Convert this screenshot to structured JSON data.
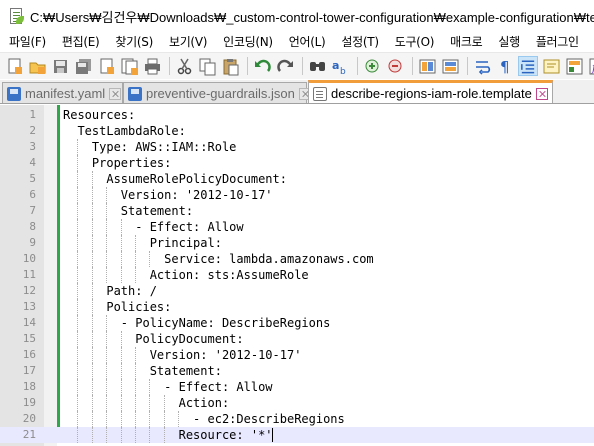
{
  "window": {
    "title": "C:₩Users₩김건우₩Downloads₩_custom-control-tower-configuration₩example-configuration₩templates₩d"
  },
  "menu": [
    "파일(F)",
    "편집(E)",
    "찾기(S)",
    "보기(V)",
    "인코딩(N)",
    "언어(L)",
    "설정(T)",
    "도구(O)",
    "매크로",
    "실행",
    "플러그인"
  ],
  "toolbar": {
    "buttons": [
      "new-file-icon",
      "open-file-icon",
      "save-icon",
      "save-all-icon",
      "close-icon",
      "close-all-icon",
      "print-icon",
      "cut-icon",
      "copy-icon",
      "paste-icon",
      "undo-icon",
      "redo-icon",
      "find-icon",
      "replace-icon",
      "zoom-in-icon",
      "zoom-out-icon",
      "sync-vertical-icon",
      "sync-horizontal-icon",
      "word-wrap-icon",
      "show-all-chars-icon",
      "indent-guide-icon",
      "udl-icon",
      "doc-map-icon",
      "function-list-icon"
    ],
    "active": "indent-guide-icon"
  },
  "tabs": [
    {
      "label": "manifest.yaml",
      "icon": "file-saved-icon",
      "active": false
    },
    {
      "label": "preventive-guardrails.json",
      "icon": "file-saved-icon",
      "active": false
    },
    {
      "label": "describe-regions-iam-role.template",
      "icon": "file-plain-icon",
      "active": true
    }
  ],
  "editor": {
    "current_line": 21,
    "lines": [
      {
        "n": "1",
        "text": "Resources:"
      },
      {
        "n": "2",
        "text": "  TestLambdaRole:"
      },
      {
        "n": "3",
        "text": "    Type: AWS::IAM::Role"
      },
      {
        "n": "4",
        "text": "    Properties:"
      },
      {
        "n": "5",
        "text": "      AssumeRolePolicyDocument:"
      },
      {
        "n": "6",
        "text": "        Version: '2012-10-17'"
      },
      {
        "n": "7",
        "text": "        Statement:"
      },
      {
        "n": "8",
        "text": "          - Effect: Allow"
      },
      {
        "n": "9",
        "text": "            Principal:"
      },
      {
        "n": "10",
        "text": "              Service: lambda.amazonaws.com"
      },
      {
        "n": "11",
        "text": "            Action: sts:AssumeRole"
      },
      {
        "n": "12",
        "text": "      Path: /"
      },
      {
        "n": "13",
        "text": "      Policies:"
      },
      {
        "n": "14",
        "text": "        - PolicyName: DescribeRegions"
      },
      {
        "n": "15",
        "text": "          PolicyDocument:"
      },
      {
        "n": "16",
        "text": "            Version: '2012-10-17'"
      },
      {
        "n": "17",
        "text": "            Statement:"
      },
      {
        "n": "18",
        "text": "              - Effect: Allow"
      },
      {
        "n": "19",
        "text": "                Action:"
      },
      {
        "n": "20",
        "text": "                  - ec2:DescribeRegions"
      },
      {
        "n": "21",
        "text": "                Resource: '*'"
      }
    ]
  },
  "colors": {
    "active_tab_accent": "#f29d3c",
    "change_bar": "#2fa84a",
    "current_line": "#e8e8ff",
    "close_active": "#c0478b"
  }
}
